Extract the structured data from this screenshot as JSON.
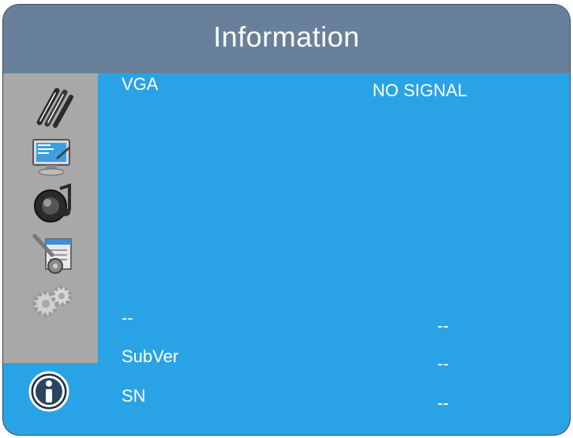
{
  "window": {
    "title": "Information"
  },
  "sidebar": {
    "items": [
      {
        "icon": "picture-pens-icon"
      },
      {
        "icon": "display-settings-icon"
      },
      {
        "icon": "audio-speaker-icon"
      },
      {
        "icon": "tools-settings-icon"
      },
      {
        "icon": "gears-icon"
      },
      {
        "icon": "info-icon",
        "active": true
      }
    ]
  },
  "info": {
    "source_label": "VGA",
    "source_value": "NO SIGNAL",
    "resolution_label": "--",
    "resolution_value": "--",
    "subver_label": "SubVer",
    "subver_value": "--",
    "sn_label": "SN",
    "sn_value": "--"
  },
  "colors": {
    "panel": "#2aa3e6",
    "title_bar": "#69809a",
    "sidebar": "#a8a8a8",
    "text": "#ffffff"
  }
}
